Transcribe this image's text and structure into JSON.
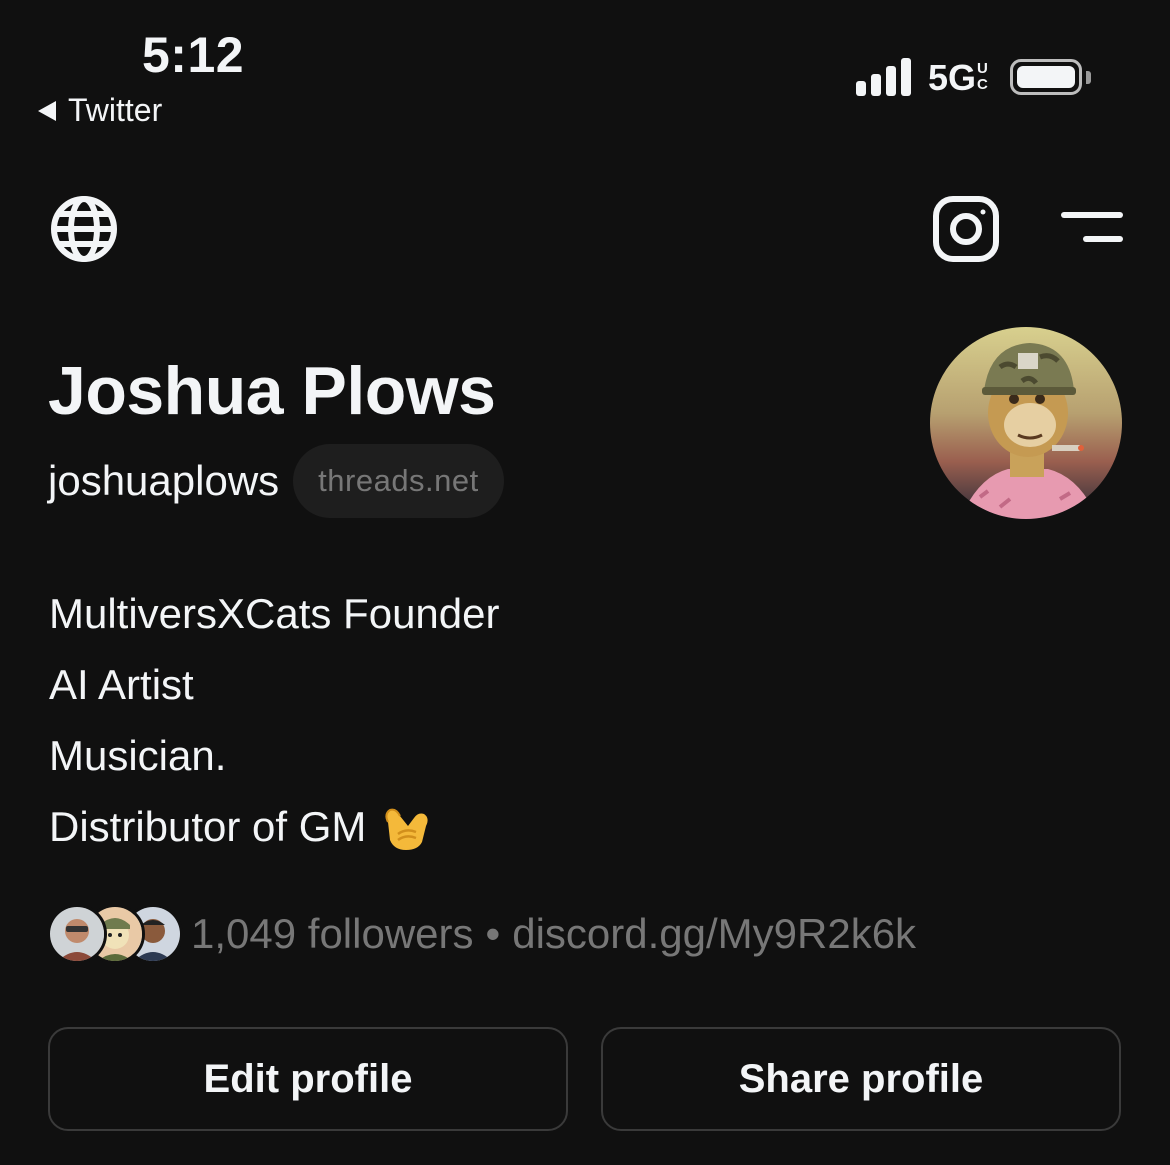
{
  "status_bar": {
    "time": "5:12",
    "back_label": "Twitter",
    "network": "5G",
    "network_sup_top": "U",
    "network_sup_bottom": "C"
  },
  "header": {
    "left_icon": "globe-icon",
    "right_icons": [
      "instagram-icon",
      "menu-icon"
    ]
  },
  "profile": {
    "name": "Joshua Plows",
    "handle": "joshuaplows",
    "domain_badge": "threads.net",
    "bio": [
      "MultiversXCats Founder",
      "AI Artist",
      "Musician.",
      "Distributor of GM"
    ],
    "bio_emoji": "call-me-hand-emoji",
    "followers": "1,049 followers",
    "separator": "•",
    "link": "discord.gg/My9R2k6k"
  },
  "actions": {
    "edit_label": "Edit profile",
    "share_label": "Share profile"
  },
  "colors": {
    "background": "#101010",
    "text": "#f3f5f7",
    "muted": "#777777",
    "border": "#3a3a3a"
  }
}
